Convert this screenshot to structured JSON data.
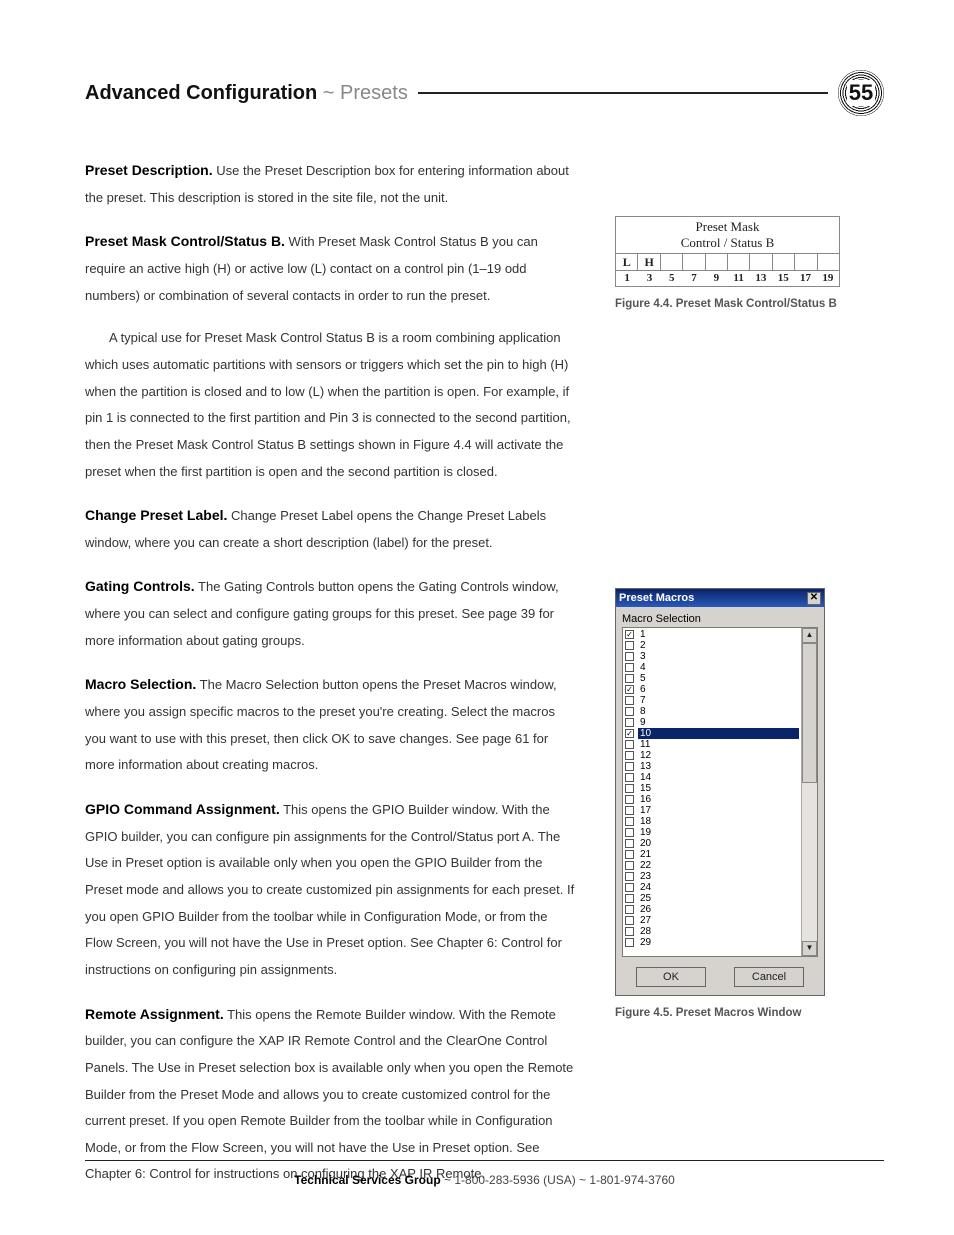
{
  "header": {
    "title_bold": "Advanced Configuration",
    "title_sep": " ~ ",
    "title_light": "Presets",
    "page_number": "55"
  },
  "paras": {
    "p1_lead": "Preset Description.",
    "p1_body": " Use the Preset Description box for entering information about the preset. This description is stored in the site file, not the unit.",
    "p2_lead": "Preset Mask Control/Status B.",
    "p2_body": " With Preset Mask Control Status B you can require an active high (H) or active low (L) contact on a control pin (1–19 odd numbers) or combination of several contacts in order to run the preset.",
    "p2b_body": "A typical use for Preset Mask Control Status B is a room combining application which uses automatic partitions with sensors or triggers which set the pin to high (H) when the partition is closed and to low (L) when the partition is open. For example, if pin 1 is connected to the first partition and Pin 3 is connected to the second partition, then the Preset Mask Control Status B settings shown in Figure 4.4 will activate the preset when the first partition is open and the second partition is closed.",
    "p3_lead": "Change Preset Label.",
    "p3_body": " Change Preset Label opens the Change Preset Labels window, where you can create a short description (label) for the preset.",
    "p4_lead": "Gating Controls.",
    "p4_body": " The Gating Controls button opens the Gating Controls window, where you can select and configure gating groups for this preset. See page 39 for more information about gating groups.",
    "p5_lead": "Macro Selection.",
    "p5_body": " The Macro Selection button opens the Preset Macros window, where you assign specific macros to the preset you're creating. Select the macros you want to use with this preset, then click OK to save changes. See page 61 for more information about creating macros.",
    "p6_lead": "GPIO Command Assignment.",
    "p6_body": " This opens the GPIO Builder window. With the GPIO builder, you can configure pin assignments for the Control/Status port A. The Use in Preset option is available only when you open the GPIO Builder from the Preset mode and allows you to create customized pin assignments for each preset. If you open GPIO Builder from the toolbar while in Configuration Mode, or from the Flow Screen, you will not have the Use in Preset option. See Chapter 6: Control for instructions on configuring pin assignments.",
    "p7_lead": "Remote Assignment.",
    "p7_body": " This opens the Remote Builder window. With the Remote builder, you can configure the XAP IR Remote Control and the ClearOne Control Panels. The Use in Preset selection box is available only when you open the Remote Builder from the Preset Mode and allows you to create customized control for the current preset. If you open Remote Builder from the toolbar while in Configuration Mode, or from the Flow Screen, you will not have the Use in Preset option. See Chapter 6: Control for instructions on configuring the XAP IR Remote."
  },
  "fig44": {
    "title1": "Preset Mask",
    "title2": "Control / Status B",
    "cells": [
      "L",
      "H",
      "",
      "",
      "",
      "",
      "",
      "",
      "",
      ""
    ],
    "nums": [
      "1",
      "3",
      "5",
      "7",
      "9",
      "11",
      "13",
      "15",
      "17",
      "19"
    ],
    "caption": "Figure 4.4. Preset Mask Control/Status B"
  },
  "fig45": {
    "title": "Preset Macros",
    "label": "Macro Selection",
    "rows": [
      {
        "n": "1",
        "c": true
      },
      {
        "n": "2",
        "c": false
      },
      {
        "n": "3",
        "c": false
      },
      {
        "n": "4",
        "c": false
      },
      {
        "n": "5",
        "c": false
      },
      {
        "n": "6",
        "c": true
      },
      {
        "n": "7",
        "c": false
      },
      {
        "n": "8",
        "c": false
      },
      {
        "n": "9",
        "c": false
      },
      {
        "n": "10",
        "c": true,
        "sel": true
      },
      {
        "n": "11",
        "c": false
      },
      {
        "n": "12",
        "c": false
      },
      {
        "n": "13",
        "c": false
      },
      {
        "n": "14",
        "c": false
      },
      {
        "n": "15",
        "c": false
      },
      {
        "n": "16",
        "c": false
      },
      {
        "n": "17",
        "c": false
      },
      {
        "n": "18",
        "c": false
      },
      {
        "n": "19",
        "c": false
      },
      {
        "n": "20",
        "c": false
      },
      {
        "n": "21",
        "c": false
      },
      {
        "n": "22",
        "c": false
      },
      {
        "n": "23",
        "c": false
      },
      {
        "n": "24",
        "c": false
      },
      {
        "n": "25",
        "c": false
      },
      {
        "n": "26",
        "c": false
      },
      {
        "n": "27",
        "c": false
      },
      {
        "n": "28",
        "c": false
      },
      {
        "n": "29",
        "c": false
      }
    ],
    "ok": "OK",
    "cancel": "Cancel",
    "caption": "Figure 4.5. Preset Macros Window"
  },
  "footer": {
    "group": "Technical Services Group",
    "rest": " ~ 1-800-283-5936 (USA) ~ 1-801-974-3760"
  }
}
